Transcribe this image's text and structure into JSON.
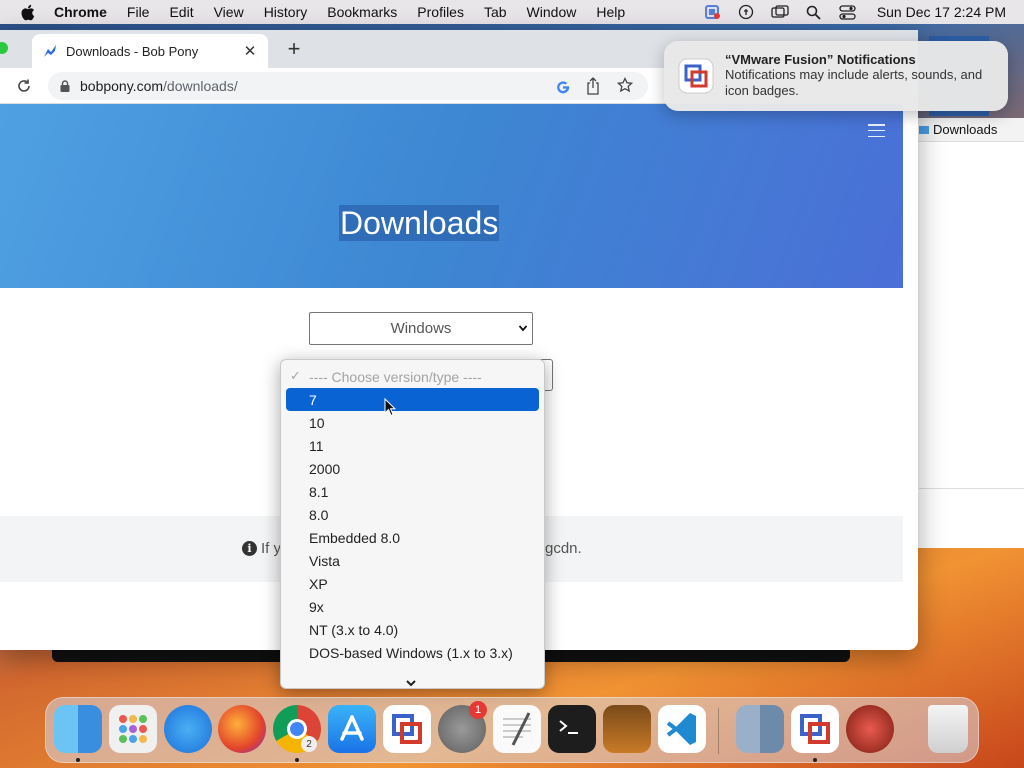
{
  "menubar": {
    "app_name": "Chrome",
    "items": [
      "File",
      "Edit",
      "View",
      "History",
      "Bookmarks",
      "Profiles",
      "Tab",
      "Window",
      "Help"
    ],
    "clock": "Sun Dec 17  2:24 PM"
  },
  "notification": {
    "title": "“VMware Fusion” Notifications",
    "body": "Notifications may include alerts, sounds, and icon badges."
  },
  "browser": {
    "tab_title": "Downloads - Bob Pony",
    "url_host": "bobpony.com",
    "url_path": "/downloads/"
  },
  "background_window": {
    "header_label": "Downloads"
  },
  "page": {
    "hero_title": "Downloads",
    "os_select_value": "Windows",
    "info_prefix": "If y",
    "info_suffix": "gcdn."
  },
  "dropdown": {
    "placeholder": "---- Choose version/type ----",
    "check_mark": "✓",
    "selected_index": 0,
    "options": [
      "7",
      "10",
      "11",
      "2000",
      "8.1",
      "8.0",
      "Embedded 8.0",
      "Vista",
      "XP",
      "9x",
      "NT (3.x to 4.0)",
      "DOS-based Windows (1.x to 3.x)"
    ]
  },
  "dock": {
    "apps": [
      "finder-icon",
      "launchpad-icon",
      "safari-icon",
      "firefox-icon",
      "chrome-icon",
      "app-store-icon",
      "vmware-fusion-icon",
      "system-settings-icon",
      "textedit-icon",
      "terminal-icon",
      "garageband-icon",
      "vscode-icon",
      "finder-folder-icon",
      "vmware-fusion-running-icon",
      "network-utility-icon",
      "trash-icon"
    ],
    "settings_badge": "1",
    "chrome_badge": "2"
  },
  "colors": {
    "hero_blue": "#3d86d2",
    "selection_blue": "#0a63d3",
    "badge_red": "#e53935"
  }
}
